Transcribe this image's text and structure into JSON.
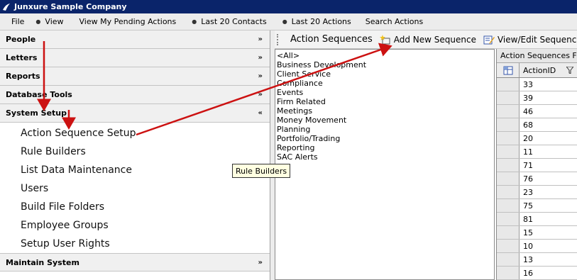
{
  "window": {
    "title": "Junxure Sample Company"
  },
  "menu": [
    {
      "label": "File",
      "dot": false
    },
    {
      "label": "View",
      "dot": true
    },
    {
      "label": "View My Pending Actions",
      "dot": false
    },
    {
      "label": "Last 20 Contacts",
      "dot": true
    },
    {
      "label": "Last 20 Actions",
      "dot": true
    },
    {
      "label": "Search Actions",
      "dot": false
    }
  ],
  "sidebar": {
    "sections": [
      {
        "label": "People",
        "chevron": "»"
      },
      {
        "label": "Letters",
        "chevron": "»"
      },
      {
        "label": "Reports",
        "chevron": "»"
      },
      {
        "label": "Database Tools",
        "chevron": "»"
      },
      {
        "label": "System Setup",
        "chevron": "«"
      }
    ],
    "system_setup_items": [
      "Action Sequence Setup",
      "Rule Builders",
      "List Data Maintenance",
      "Users",
      "Build File Folders",
      "Employee Groups",
      "Setup User Rights"
    ],
    "footer_section": {
      "label": "Maintain System",
      "chevron": "»"
    }
  },
  "toolbar": {
    "title": "Action Sequences",
    "add_label": "Add New  Sequence",
    "edit_label": "View/Edit Sequence"
  },
  "sequence_list": [
    "<All>",
    "Business Development",
    "Client Service",
    "Compliance",
    "Events",
    "Firm Related",
    "Meetings",
    "Money Movement",
    "Planning",
    "Portfolio/Trading",
    "Reporting",
    "SAC Alerts"
  ],
  "grid": {
    "caption": "Action Sequences For",
    "column": "ActionID",
    "rows": [
      "33",
      "39",
      "46",
      "68",
      "20",
      "11",
      "71",
      "76",
      "23",
      "75",
      "81",
      "15",
      "10",
      "13",
      "16"
    ]
  },
  "tooltip": {
    "text": "Rule Builders"
  },
  "colors": {
    "titlebar": "#0a246a",
    "annotation_arrow": "#cc1111",
    "tooltip_bg": "#ffffe1"
  }
}
